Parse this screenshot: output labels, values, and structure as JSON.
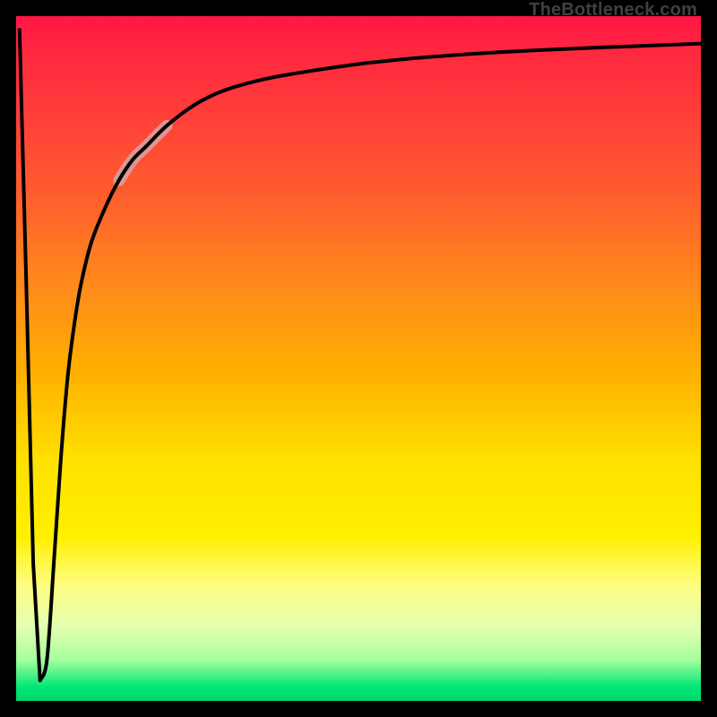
{
  "watermark": "TheBottleneck.com",
  "chart_data": {
    "type": "line",
    "title": "",
    "xlabel": "",
    "ylabel": "",
    "xlim": [
      0,
      100
    ],
    "ylim": [
      0,
      100
    ],
    "x": [
      0.5,
      1.5,
      2.5,
      3.5,
      4.5,
      5.5,
      6.5,
      7.5,
      8.5,
      9.5,
      11,
      13,
      15,
      17,
      19,
      22,
      26,
      30,
      35,
      40,
      50,
      60,
      70,
      80,
      90,
      100
    ],
    "y": [
      98,
      60,
      20,
      3,
      6,
      20,
      35,
      47,
      55,
      61,
      67,
      72,
      76,
      79,
      81,
      84,
      87,
      89,
      90.5,
      91.5,
      93,
      94,
      94.7,
      95.2,
      95.6,
      96
    ],
    "highlight_range_x": [
      15,
      22
    ],
    "background_gradient": {
      "stops": [
        {
          "pos": 0.0,
          "color": "#ff1744"
        },
        {
          "pos": 0.4,
          "color": "#ff8c1a"
        },
        {
          "pos": 0.65,
          "color": "#ffe100"
        },
        {
          "pos": 0.94,
          "color": "#a6ff9e"
        },
        {
          "pos": 1.0,
          "color": "#00d966"
        }
      ],
      "direction": "top-to-bottom"
    },
    "notes": "Sharp V-shaped dip near x≈3.5 reaching y≈3, then logarithmic-like rise toward y≈96."
  }
}
